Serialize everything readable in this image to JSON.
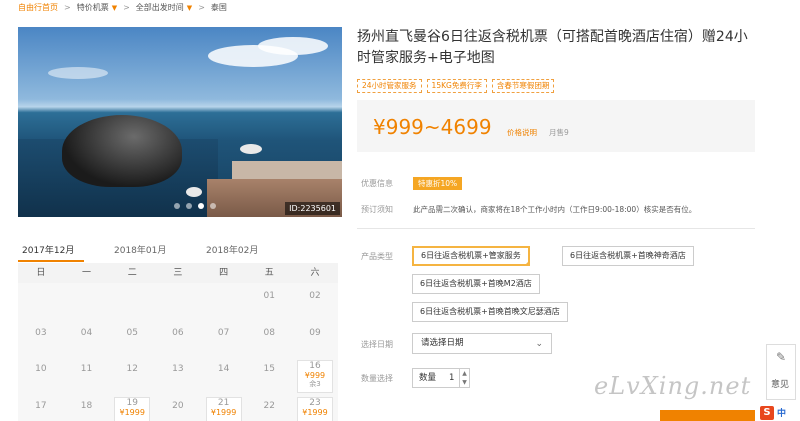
{
  "breadcrumb": {
    "home": "自由行首页",
    "items": [
      "特价机票",
      "全部出发时间",
      "泰国"
    ]
  },
  "gallery": {
    "image_id": "ID:2235601",
    "slide_count": 4,
    "active_slide": 3
  },
  "calendar": {
    "months": [
      "2017年12月",
      "2018年01月",
      "2018年02月"
    ],
    "active_month": 0,
    "weekdays": [
      "日",
      "一",
      "二",
      "三",
      "四",
      "五",
      "六"
    ],
    "rows": [
      [
        {
          "d": ""
        },
        {
          "d": ""
        },
        {
          "d": ""
        },
        {
          "d": ""
        },
        {
          "d": ""
        },
        {
          "d": "01"
        },
        {
          "d": "02"
        }
      ],
      [
        {
          "d": "03"
        },
        {
          "d": "04"
        },
        {
          "d": "05"
        },
        {
          "d": "06"
        },
        {
          "d": "07"
        },
        {
          "d": "08"
        },
        {
          "d": "09"
        }
      ],
      [
        {
          "d": "10"
        },
        {
          "d": "11"
        },
        {
          "d": "12"
        },
        {
          "d": "13"
        },
        {
          "d": "14"
        },
        {
          "d": "15"
        },
        {
          "d": "16",
          "price": "¥999",
          "stock": "余3"
        }
      ],
      [
        {
          "d": "17"
        },
        {
          "d": "18"
        },
        {
          "d": "19",
          "price": "¥1999"
        },
        {
          "d": "20"
        },
        {
          "d": "21",
          "price": "¥1999"
        },
        {
          "d": "22"
        },
        {
          "d": "23",
          "price": "¥1999"
        }
      ]
    ]
  },
  "product": {
    "title": "扬州直飞曼谷6日往返含税机票（可搭配首晚酒店住宿）赠24小时管家服务+电子地图",
    "tags": [
      "24小时管家服务",
      "15KG免费行李",
      "含春节寒假团期"
    ],
    "price": "¥999~4699",
    "price_note": "价格说明",
    "sold": "月售9"
  },
  "offers": {
    "label": "优惠信息",
    "badge": "特惠折10%"
  },
  "booking": {
    "label": "预订须知",
    "text": "此产品需二次确认，商家将在18个工作小时内（工作日9:00-18:00）核实是否有位。"
  },
  "product_type": {
    "label": "产品类型",
    "options": [
      "6日往返含税机票+管家服务",
      "6日往返含税机票+首晚神奇酒店",
      "6日往返含税机票+首晚M2酒店",
      "6日往返含税机票+首晚首晚文尼瑟酒店"
    ],
    "selected": 0
  },
  "date": {
    "label": "选择日期",
    "placeholder": "请选择日期"
  },
  "quantity": {
    "label": "数量选择",
    "prefix": "数量",
    "value": "1"
  },
  "float_widget": {
    "label": "意见"
  },
  "ime": {
    "letter": "S",
    "mode": "中"
  },
  "watermark": "eLvXing.net"
}
